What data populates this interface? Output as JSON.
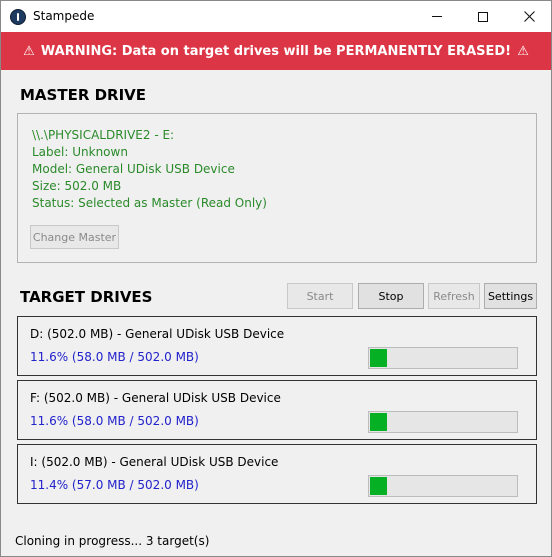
{
  "window": {
    "title": "Stampede"
  },
  "warning": {
    "icon": "warning-triangle-icon",
    "glyph": "⚠",
    "text": "WARNING: Data on target drives will be PERMANENTLY ERASED!",
    "color": "#dc3545"
  },
  "master": {
    "heading": "MASTER DRIVE",
    "path": "\\\\.\\PHYSICALDRIVE2 - E:",
    "label": "Label: Unknown",
    "model": "Model: General UDisk USB Device",
    "size": "Size: 502.0 MB",
    "status": "Status: Selected as Master (Read Only)",
    "change_button": "Change Master",
    "text_color": "#2a8a2a"
  },
  "targets": {
    "heading": "TARGET DRIVES",
    "buttons": {
      "start": "Start",
      "stop": "Stop",
      "refresh": "Refresh",
      "settings": "Settings"
    },
    "drives": [
      {
        "name": "D: (502.0 MB) - General UDisk USB Device",
        "progress_text": "11.6% (58.0 MB / 502.0 MB)",
        "progress": 0.116
      },
      {
        "name": "F: (502.0 MB) - General UDisk USB Device",
        "progress_text": "11.6% (58.0 MB / 502.0 MB)",
        "progress": 0.116
      },
      {
        "name": "I: (502.0 MB) - General UDisk USB Device",
        "progress_text": "11.4% (57.0 MB / 502.0 MB)",
        "progress": 0.114
      }
    ],
    "progress_color": "#06b025"
  },
  "status_bar": {
    "text": "Cloning in progress... 3 target(s)"
  }
}
